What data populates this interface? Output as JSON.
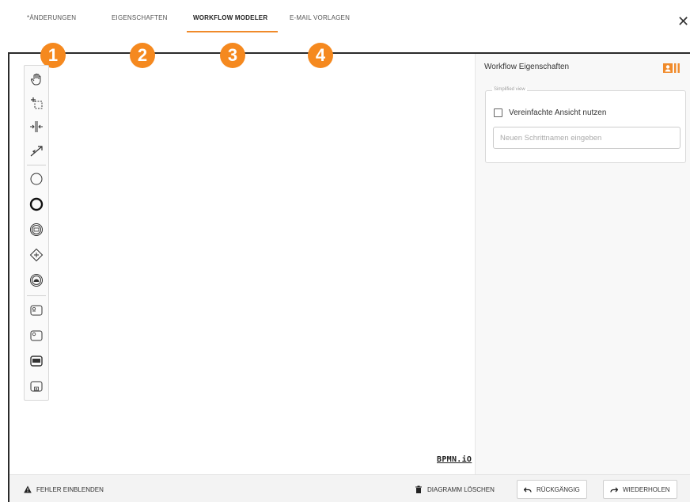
{
  "tabs": [
    {
      "label": "*ÄNDERUNGEN"
    },
    {
      "label": "EIGENSCHAFTEN"
    },
    {
      "label": "WORKFLOW MODELER",
      "active": true
    },
    {
      "label": "E-MAIL VORLAGEN"
    }
  ],
  "close_glyph": "✕",
  "badges": [
    "1",
    "2",
    "3",
    "4"
  ],
  "accent_color": "#f5891f",
  "palette": {
    "tools": [
      {
        "name": "hand-tool-icon"
      },
      {
        "name": "lasso-tool-icon"
      },
      {
        "name": "space-tool-icon"
      },
      {
        "name": "global-connect-tool-icon"
      },
      {
        "name": "start-event-icon"
      },
      {
        "name": "end-event-icon"
      },
      {
        "name": "intermediate-event-icon"
      },
      {
        "name": "gateway-icon"
      },
      {
        "name": "boundary-event-icon"
      },
      {
        "name": "task-icon"
      },
      {
        "name": "user-task-icon"
      },
      {
        "name": "service-task-icon"
      },
      {
        "name": "subprocess-icon"
      }
    ]
  },
  "canvas": {
    "logo_text": "BPMN.iO"
  },
  "properties": {
    "title": "Workflow Eigenschaften",
    "fieldset_legend": "Simplified view",
    "checkbox_label": "Vereinfachte Ansicht nutzen",
    "checkbox_checked": false,
    "step_name_placeholder": "Neuen Schrittnamen eingeben",
    "step_name_value": ""
  },
  "bottom_bar": {
    "show_errors": "FEHLER EINBLENDEN",
    "delete_diagram": "DIAGRAMM LÖSCHEN",
    "undo": "RÜCKGÄNGIG",
    "redo": "WIEDERHOLEN"
  }
}
